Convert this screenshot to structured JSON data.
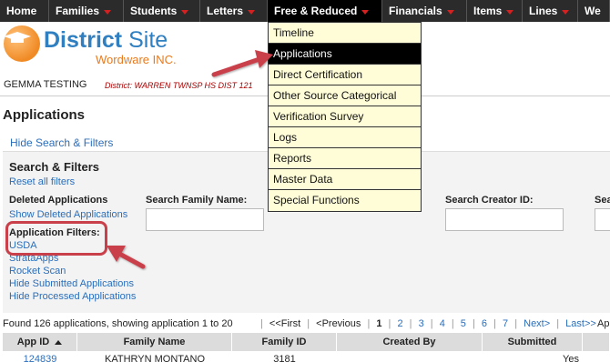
{
  "nav": {
    "items": [
      {
        "label": "Home",
        "caret": false
      },
      {
        "label": "Families",
        "caret": true
      },
      {
        "label": "Students",
        "caret": true
      },
      {
        "label": "Letters",
        "caret": true
      },
      {
        "label": "Free & Reduced",
        "caret": true
      },
      {
        "label": "Financials",
        "caret": true
      },
      {
        "label": "Items",
        "caret": true
      },
      {
        "label": "Lines",
        "caret": true
      },
      {
        "label": "We",
        "caret": false
      }
    ],
    "active_index": 4
  },
  "logo": {
    "title_bold": "District",
    "title_rest": " Site",
    "subtitle": "Wordware INC."
  },
  "user": {
    "name": "GEMMA TESTING",
    "district": "District: WARREN TWNSP HS DIST 121"
  },
  "page": {
    "title": "Applications",
    "hide_search": "Hide Search & Filters"
  },
  "filters": {
    "heading": "Search & Filters",
    "reset": "Reset all filters",
    "deleted_heading": "Deleted Applications",
    "show_deleted": "Show Deleted Applications",
    "application_filters_heading": "Application Filters:",
    "links": [
      "USDA",
      "StrataApps",
      "Rocket Scan",
      "Hide Submitted Applications",
      "Hide Processed Applications"
    ],
    "search_family_label": "Search Family Name:",
    "search_creator_label": "Search Creator ID:",
    "search_partial_label": "Sea"
  },
  "dropdown": {
    "items": [
      "Timeline",
      "Applications",
      "Direct Certification",
      "Other Source Categorical",
      "Verification Survey",
      "Logs",
      "Reports",
      "Master Data",
      "Special Functions"
    ],
    "active_index": 1
  },
  "results": {
    "found_text": "Found 126 applications, showing application 1 to 20",
    "pager": {
      "first": "<<First",
      "prev": "<Previous",
      "pages": [
        "1",
        "2",
        "3",
        "4",
        "5",
        "6",
        "7"
      ],
      "current": "1",
      "next": "Next>",
      "last": "Last>>"
    },
    "ap": "Ap"
  },
  "table": {
    "headers": [
      "App ID",
      "Family Name",
      "Family ID",
      "Created By",
      "Submitted"
    ],
    "row": {
      "app_id": "124839",
      "family_name": "KATHRYN MONTANO",
      "family_id": "3181",
      "created_by": "",
      "submitted": "Yes"
    }
  },
  "colors": {
    "nav_bg": "#2b2b2b",
    "caret": "#d32020",
    "dropdown_bg": "#fffdd7",
    "link": "#2a6ebb",
    "annotation_red": "#c9404b"
  }
}
